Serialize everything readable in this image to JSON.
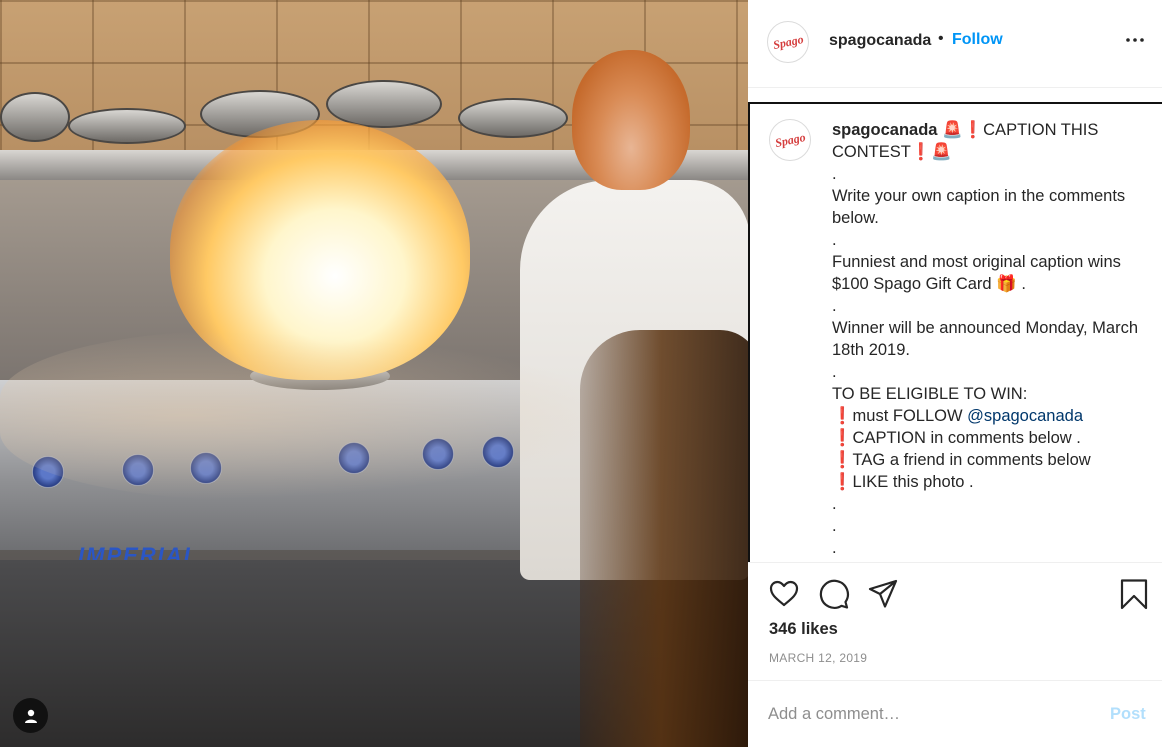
{
  "header": {
    "username": "spagocanada",
    "separator": "•",
    "follow_label": "Follow",
    "avatar_logo": "Spago",
    "more_icon": "more-options-icon"
  },
  "caption": {
    "username": "spagocanada",
    "lines": {
      "headline": " 🚨❗CAPTION THIS CONTEST❗🚨",
      "dot1": ".",
      "l1": "Write your own caption in the comments below.",
      "dot2": ".",
      "l2": "Funniest and most original caption wins $100 Spago Gift Card 🎁 .",
      "dot3": ".",
      "l3": "Winner will be announced Monday, March 18th 2019.",
      "dot4": ".",
      "l4": "TO BE ELIGIBLE TO WIN:",
      "r1_prefix": "❗must FOLLOW ",
      "r1_mention": "@spagocanada",
      "r2": "❗CAPTION in comments below .",
      "r3": "❗TAG a friend in comments below",
      "r4": "❗LIKE this photo .",
      "dot5": ".",
      "dot6": ".",
      "dot7": "."
    }
  },
  "actions": {
    "like_icon": "heart-icon",
    "comment_icon": "comment-icon",
    "share_icon": "paper-plane-icon",
    "save_icon": "bookmark-icon"
  },
  "likes": "346 likes",
  "date": "MARCH 12, 2019",
  "comment_box": {
    "placeholder": "Add a comment…",
    "post_label": "Post"
  },
  "photo": {
    "stove_brand": "IMPERIAL",
    "user_tag_icon": "user-tag-icon"
  },
  "colors": {
    "link_blue": "#0095f6",
    "post_disabled": "#b2dffc",
    "mention": "#00376b",
    "muted": "#8e8e8e"
  }
}
